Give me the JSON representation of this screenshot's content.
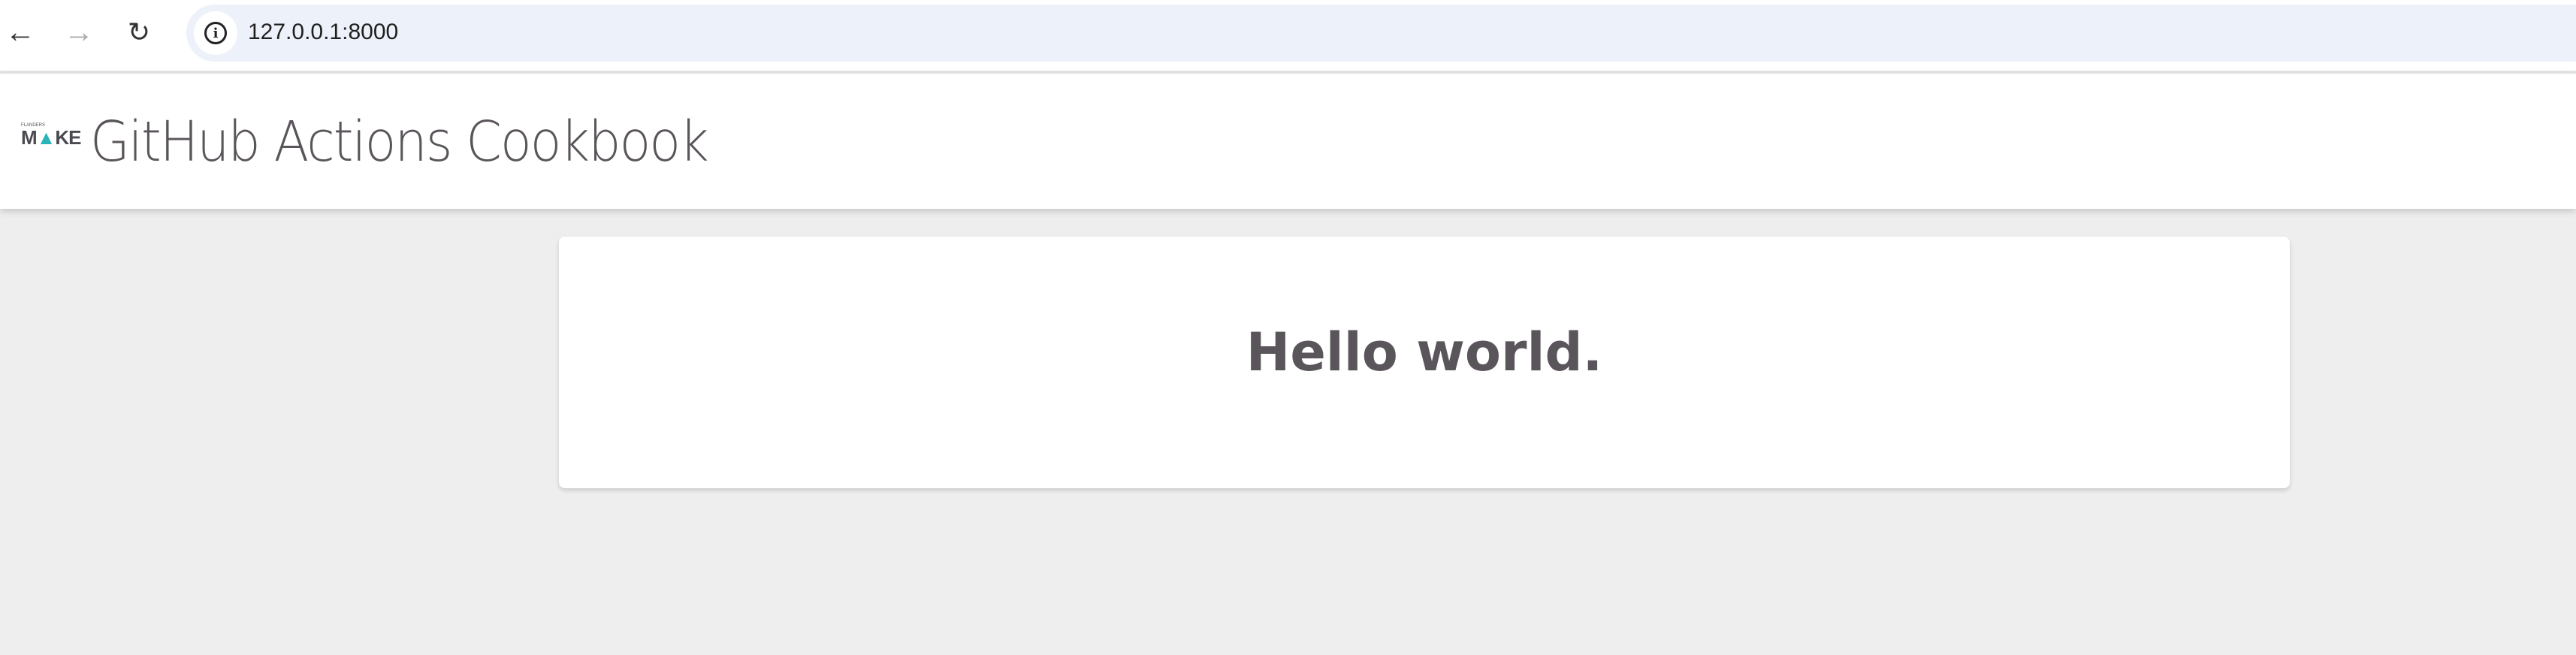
{
  "browser": {
    "url": "127.0.0.1:8000",
    "back_icon": "arrow-left-icon",
    "forward_icon": "arrow-right-icon",
    "reload_icon": "reload-icon",
    "site_info_icon": "info-icon"
  },
  "header": {
    "logo_text": "FLANDERS MAKE",
    "title": "GitHub Actions Cookbook"
  },
  "main": {
    "heading": "Hello world."
  },
  "colors": {
    "background": "#eeeeee",
    "text": "#5a555a",
    "logo_accent": "#2bb5b8"
  }
}
